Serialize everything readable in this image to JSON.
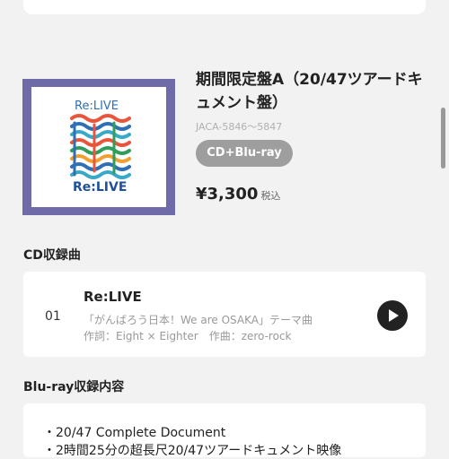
{
  "product": {
    "title": "期間限定盤A（20/47ツアードキュメント盤）",
    "catalog_number": "JACA-5846〜5847",
    "format_badge": "CD+Blu-ray",
    "price": "¥3,300",
    "tax_label": "税込",
    "cover_text": "Re:LIVE",
    "cover_border_color": "#6f6aa8"
  },
  "cd_section": {
    "title": "CD収録曲",
    "tracks": [
      {
        "number": "01",
        "title": "Re:LIVE",
        "tie_in": "「がんばろう日本！We are OSAKA」テーマ曲",
        "credits": "作詞：Eight × Eighter　作曲：zero-rock",
        "play_icon": "play-icon"
      }
    ]
  },
  "bluray_section": {
    "title": "Blu-ray収録内容",
    "items": [
      "・20/47 Complete Document",
      "・2時間25分の超長尺20/47ツアードキュメント映像"
    ]
  }
}
